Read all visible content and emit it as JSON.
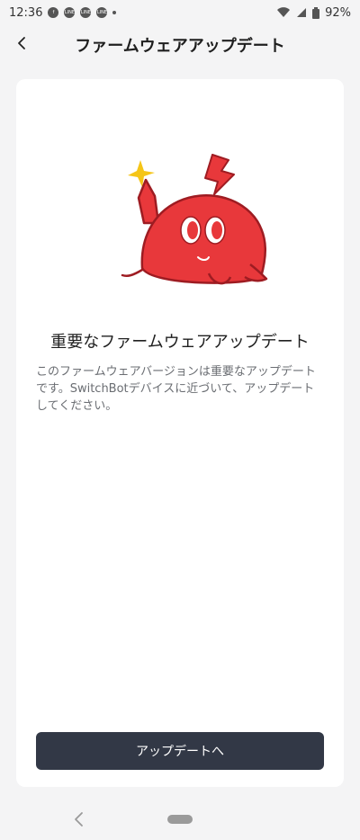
{
  "status_bar": {
    "time": "12:36",
    "notification_icons": [
      "facebook-icon",
      "line-icon",
      "line-icon",
      "line-icon"
    ],
    "battery": "92%"
  },
  "header": {
    "back_icon": "chevron-left-icon",
    "title": "ファームウェアアップデート"
  },
  "content": {
    "heading": "重要なファームウェアアップデート",
    "description": "このファームウェアバージョンは重要なアップデートです。SwitchBotデバイスに近づいて、アップデートしてください。"
  },
  "actions": {
    "update_button_label": "アップデートへ"
  },
  "colors": {
    "button": "#323846",
    "mascot": "#e8383b",
    "sparkle": "#f5c518"
  }
}
